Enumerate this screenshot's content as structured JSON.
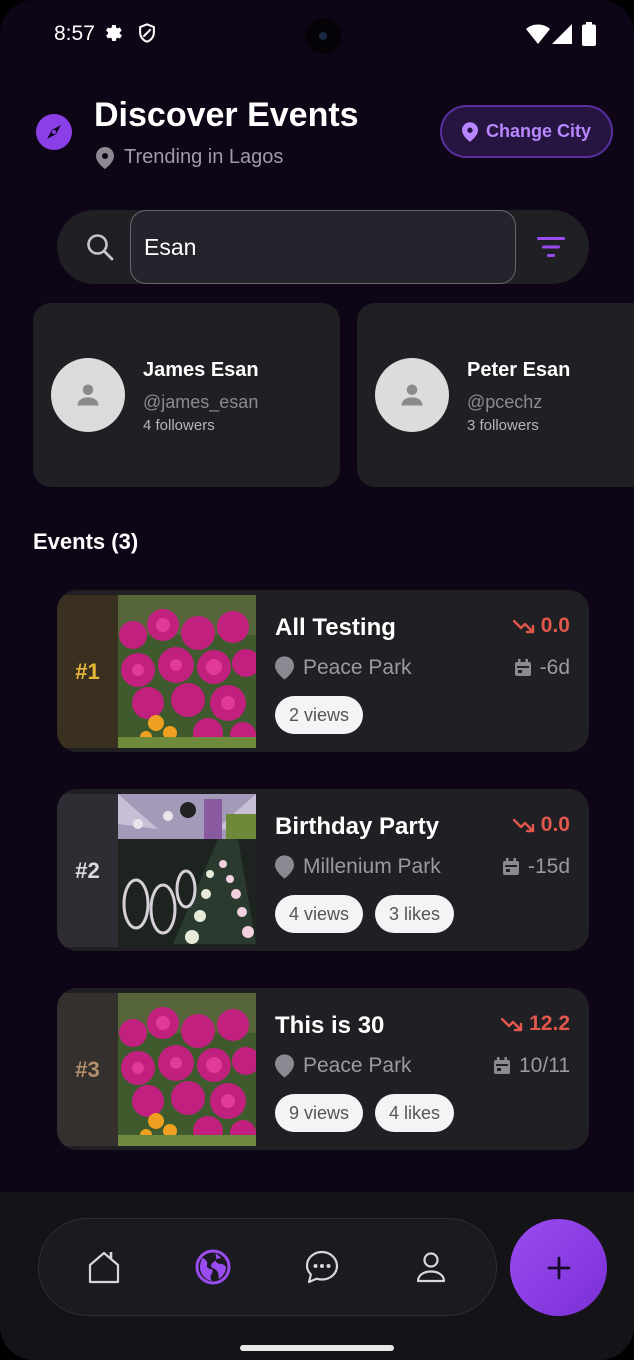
{
  "status_bar": {
    "time": "8:57",
    "icons": [
      "gear-icon",
      "shield-icon",
      "wifi-icon",
      "signal-icon",
      "battery-icon"
    ]
  },
  "header": {
    "title": "Discover Events",
    "subtitle": "Trending in Lagos",
    "change_city_label": "Change City"
  },
  "search": {
    "value": "Esan"
  },
  "users": [
    {
      "name": "James Esan",
      "handle": "@james_esan",
      "followers": "4 followers"
    },
    {
      "name": "Peter Esan",
      "handle": "@pcechz",
      "followers": "3 followers"
    }
  ],
  "events_heading": "Events (3)",
  "events": [
    {
      "rank": "#1",
      "title": "All Testing",
      "location": "Peace Park",
      "trend": "0.0",
      "date": "-6d",
      "views": "2 views",
      "likes": ""
    },
    {
      "rank": "#2",
      "title": "Birthday Party",
      "location": "Millenium Park",
      "trend": "0.0",
      "date": "-15d",
      "views": "4 views",
      "likes": "3 likes"
    },
    {
      "rank": "#3",
      "title": "This is 30",
      "location": "Peace Park",
      "trend": "12.2",
      "date": "10/11",
      "views": "9 views",
      "likes": "4 likes"
    }
  ],
  "colors": {
    "accent": "#8b3fe6",
    "trend_down": "#e2574c",
    "rank1": "#e8b73a",
    "background": "#0e0616"
  },
  "nav": {
    "items": [
      "home-icon",
      "globe-icon",
      "chat-icon",
      "profile-icon"
    ],
    "active": "globe-icon",
    "fab": "plus-icon"
  }
}
